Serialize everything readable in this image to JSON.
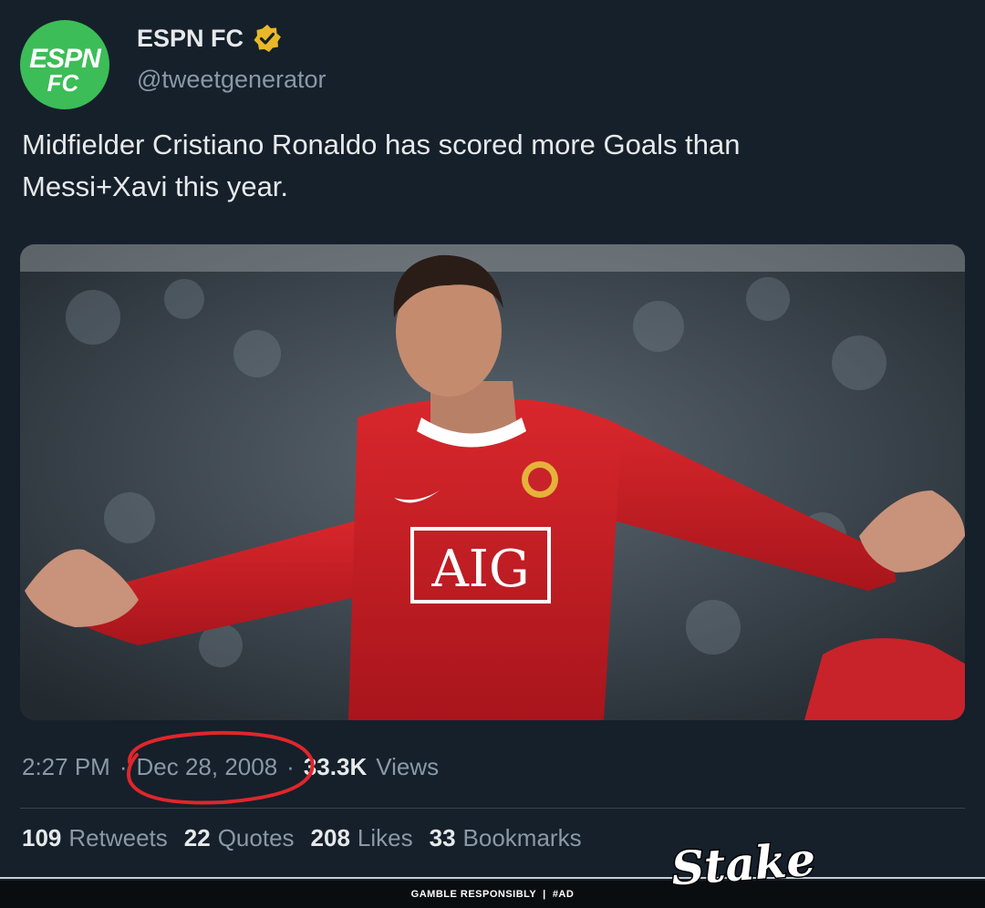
{
  "author": {
    "avatar_text_top": "ESPN",
    "avatar_text_bottom": "FC",
    "display_name": "ESPN FC",
    "handle": "@tweetgenerator",
    "verified_icon": "verified-badge-icon",
    "avatar_color": "#3cbd57",
    "verified_color": "#e8b829"
  },
  "tweet": {
    "text_line_1": "Midfielder Cristiano Ronaldo has scored more Goals than",
    "text_line_2": "Messi+Xavi this year.",
    "media": {
      "shirt_sponsor_text": "AIG"
    }
  },
  "meta": {
    "time": "2:27 PM",
    "separator": "·",
    "date": "Dec 28, 2008",
    "views_count": "33.3K",
    "views_label": "Views",
    "highlight_color": "#e0262b"
  },
  "stats": [
    {
      "count": "109",
      "label": "Retweets"
    },
    {
      "count": "22",
      "label": "Quotes"
    },
    {
      "count": "208",
      "label": "Likes"
    },
    {
      "count": "33",
      "label": "Bookmarks"
    }
  ],
  "ad": {
    "text": "GAMBLE RESPONSIBLY  |  #AD",
    "logo_text": "Stake"
  }
}
